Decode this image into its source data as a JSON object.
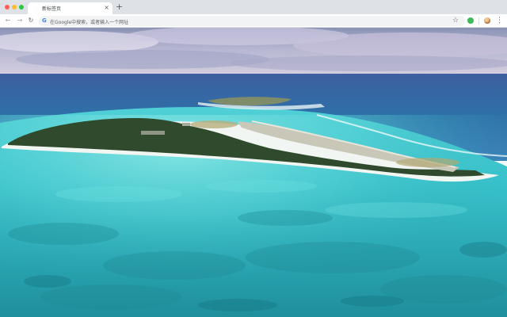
{
  "tab": {
    "title": "新标签页",
    "close_glyph": "×",
    "new_tab_glyph": "+"
  },
  "toolbar": {
    "back_glyph": "←",
    "forward_glyph": "→",
    "reload_glyph": "↻",
    "omnibox_placeholder": "在Google中搜索，或者输入一个网址",
    "google_glyph": "G",
    "star_glyph": "☆",
    "menu_glyph": "⋮"
  },
  "icons": {
    "back": "back-arrow-icon",
    "forward": "forward-arrow-icon",
    "reload": "reload-icon",
    "google": "google-g-icon",
    "star": "bookmark-star-icon",
    "extension": "extension-icon",
    "avatar": "profile-avatar",
    "menu": "kebab-menu-icon"
  },
  "colors": {
    "tabstrip": "#dee1e6",
    "omnibox": "#f1f3f4",
    "extension_green": "#3cba54"
  }
}
